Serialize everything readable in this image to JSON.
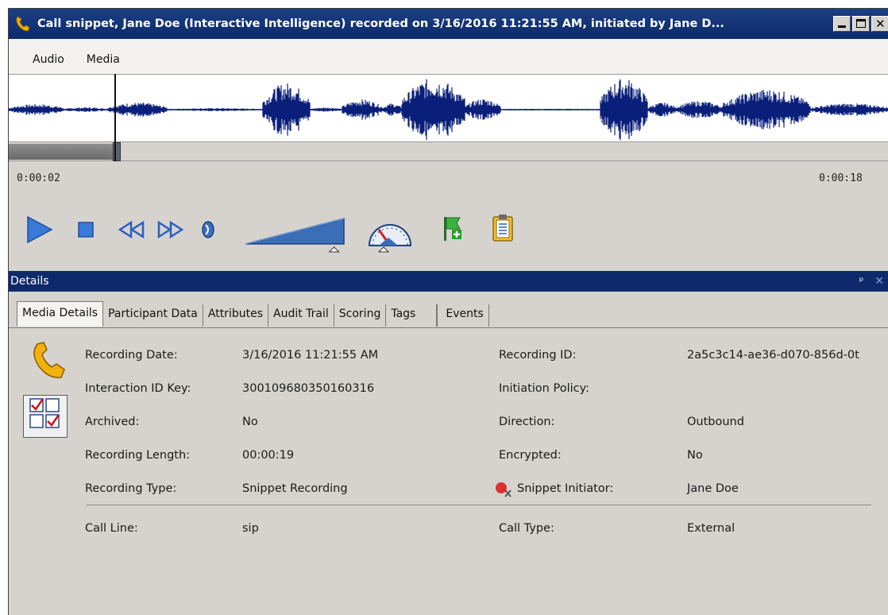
{
  "window": {
    "title": "Call snippet, Jane Doe (Interactive Intelligence) recorded on 3/16/2016 11:21:55 AM, initiated by Jane D...",
    "icon": "phone-handset-icon"
  },
  "menu": {
    "items": [
      "Audio",
      "Media"
    ]
  },
  "player": {
    "current_time": "0:00:02",
    "total_time": "0:00:18",
    "progress_fraction": 0.12,
    "volume_level": 0.9,
    "speed_level": 0.5,
    "waveform_color": "#0a1f7a"
  },
  "details": {
    "header": "Details",
    "tabs": [
      "Media Details",
      "Participant Data",
      "Attributes",
      "Audit Trail",
      "Scoring",
      "Tags",
      "Events"
    ],
    "active_tab": "Media Details",
    "left_fields": [
      {
        "label": "Recording Date:",
        "value": "3/16/2016 11:21:55 AM"
      },
      {
        "label": "Interaction ID Key:",
        "value": "300109680350160316"
      },
      {
        "label": "Archived:",
        "value": "No"
      },
      {
        "label": "Recording Length:",
        "value": "00:00:19"
      },
      {
        "label": "Recording Type:",
        "value": "Snippet Recording"
      }
    ],
    "right_fields": [
      {
        "label": "Recording ID:",
        "value": "2a5c3c14-ae36-d070-856d-0t"
      },
      {
        "label": "Initiation Policy:",
        "value": ""
      },
      {
        "label": "Direction:",
        "value": "Outbound"
      },
      {
        "label": "Encrypted:",
        "value": "No"
      },
      {
        "label": "Snippet Initiator:",
        "value": "Jane Doe"
      }
    ],
    "extra_left": {
      "label": "Call Line:",
      "value": "sip"
    },
    "extra_right": {
      "label": "Call Type:",
      "value": "External"
    }
  }
}
